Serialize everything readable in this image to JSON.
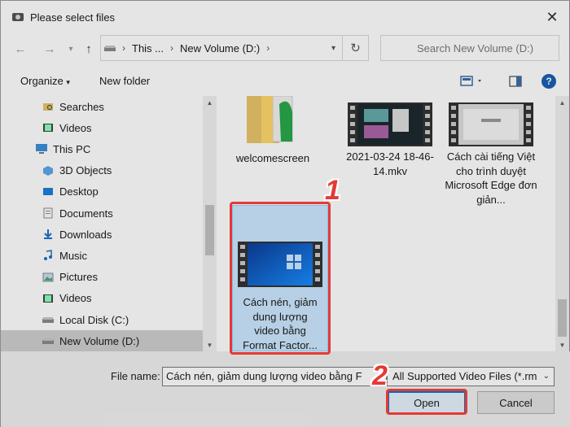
{
  "window": {
    "title": "Please select files"
  },
  "address": {
    "crumbs": [
      "This ...",
      "New Volume (D:)"
    ],
    "search_placeholder": "Search New Volume (D:)"
  },
  "toolbar": {
    "organize": "Organize",
    "new_folder": "New folder",
    "help": "?"
  },
  "nav_items": [
    {
      "label": "Searches",
      "icon": "search-folder-icon"
    },
    {
      "label": "Videos",
      "icon": "videos-icon"
    },
    {
      "label": "This PC",
      "icon": "computer-icon"
    },
    {
      "label": "3D Objects",
      "icon": "3d-objects-icon"
    },
    {
      "label": "Desktop",
      "icon": "desktop-icon"
    },
    {
      "label": "Documents",
      "icon": "documents-icon"
    },
    {
      "label": "Downloads",
      "icon": "downloads-icon"
    },
    {
      "label": "Music",
      "icon": "music-icon"
    },
    {
      "label": "Pictures",
      "icon": "pictures-icon"
    },
    {
      "label": "Videos",
      "icon": "videos-icon"
    },
    {
      "label": "Local Disk (C:)",
      "icon": "drive-icon"
    },
    {
      "label": "New Volume (D:)",
      "icon": "drive-icon",
      "selected": true
    }
  ],
  "files": [
    {
      "name": "welcomescreen",
      "type": "folder"
    },
    {
      "name": "2021-03-24 18-46-14.mkv",
      "type": "video"
    },
    {
      "name": "Cách cài tiếng Việt cho trình duyệt Microsoft Edge đơn giản...",
      "type": "video"
    },
    {
      "name": "Cách nén, giảm dung lượng video bằng Format Factor...",
      "type": "video",
      "selected": true
    }
  ],
  "bottom": {
    "file_name_label": "File name:",
    "file_name_value": "Cách nén, giảm dung lượng video bằng F",
    "filter_value": "All Supported Video Files (*.rm",
    "open_label": "Open",
    "cancel_label": "Cancel"
  },
  "annotations": {
    "step1": "1",
    "step2": "2"
  },
  "colors": {
    "accent": "#0078d7",
    "annotation": "#e53935",
    "selection": "#cce8ff"
  }
}
